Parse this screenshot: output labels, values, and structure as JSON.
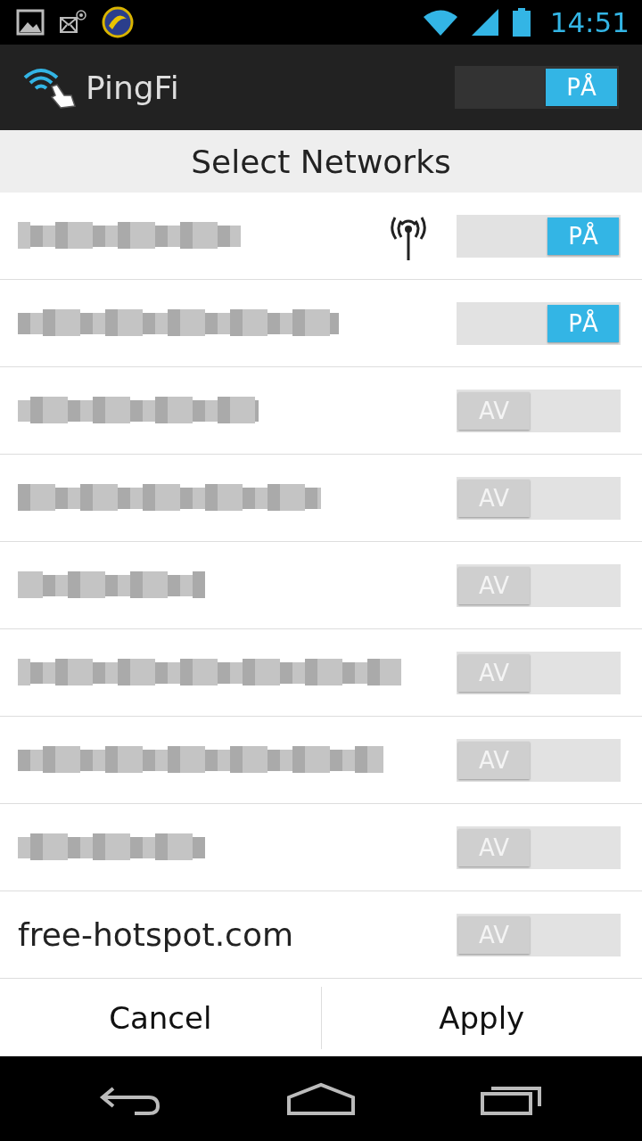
{
  "status_bar": {
    "time": "14:51"
  },
  "app_bar": {
    "title": "PingFi",
    "toggle": {
      "on": true,
      "label": "PÅ"
    }
  },
  "header": "Select Networks",
  "networks": [
    {
      "kind": "redacted",
      "connected": true,
      "toggle": {
        "on": true,
        "label": "PÅ"
      }
    },
    {
      "kind": "redacted",
      "connected": false,
      "toggle": {
        "on": true,
        "label": "PÅ"
      }
    },
    {
      "kind": "redacted",
      "connected": false,
      "toggle": {
        "on": false,
        "label": "AV"
      }
    },
    {
      "kind": "redacted",
      "connected": false,
      "toggle": {
        "on": false,
        "label": "AV"
      }
    },
    {
      "kind": "redacted",
      "connected": false,
      "toggle": {
        "on": false,
        "label": "AV"
      }
    },
    {
      "kind": "redacted",
      "connected": false,
      "toggle": {
        "on": false,
        "label": "AV"
      }
    },
    {
      "kind": "redacted",
      "connected": false,
      "toggle": {
        "on": false,
        "label": "AV"
      }
    },
    {
      "kind": "redacted",
      "connected": false,
      "toggle": {
        "on": false,
        "label": "AV"
      }
    },
    {
      "kind": "text",
      "name": "free-hotspot.com",
      "connected": false,
      "toggle": {
        "on": false,
        "label": "AV"
      }
    }
  ],
  "buttons": [
    "Cancel",
    "Apply"
  ]
}
